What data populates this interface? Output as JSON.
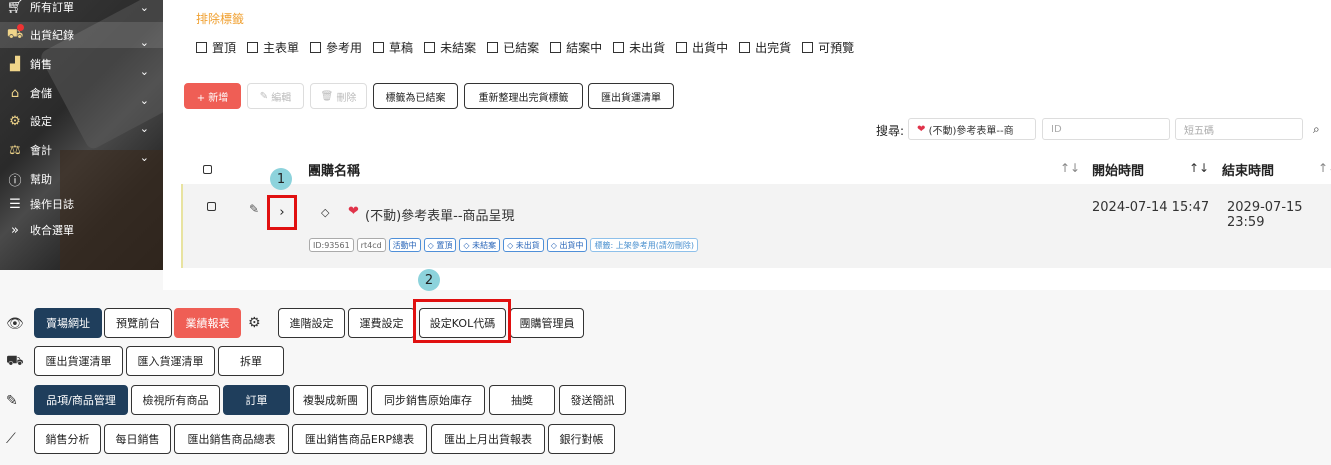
{
  "sidebar": {
    "items": [
      {
        "label": "所有訂單",
        "icon": "cart-icon"
      },
      {
        "label": "出貨紀錄",
        "icon": "truck-icon"
      },
      {
        "label": "銷售",
        "icon": "bar-chart-icon"
      },
      {
        "label": "倉儲",
        "icon": "warehouse-icon"
      },
      {
        "label": "設定",
        "icon": "gear-icon"
      },
      {
        "label": "會計",
        "icon": "scale-icon"
      },
      {
        "label": "幫助",
        "icon": "help-icon"
      },
      {
        "label": "操作日誌",
        "icon": "list-icon"
      },
      {
        "label": "收合選單",
        "icon": "double-chevron-icon"
      }
    ]
  },
  "filters": {
    "title": "排除標籤",
    "options": [
      "置頂",
      "主表單",
      "參考用",
      "草稿",
      "未結案",
      "已結案",
      "結案中",
      "未出貨",
      "出貨中",
      "出完貨",
      "可預覽"
    ]
  },
  "toolbar": {
    "add": "+ 新增",
    "edit": "編輯",
    "delete": "刪除",
    "mark_closed": "標籤為已結案",
    "reorganize": "重新整理出完貨標籤",
    "export_shipping": "匯出貨運清單"
  },
  "search": {
    "label": "搜尋:",
    "value": "(不動)參考表單--商",
    "id_placeholder": "ID",
    "code_placeholder": "短五碼"
  },
  "table": {
    "headers": {
      "name": "團購名稱",
      "start": "開始時間",
      "end": "結束時間"
    },
    "row": {
      "title": "(不動)參考表單--商品呈現",
      "start": "2024-07-14 15:47",
      "end": "2029-07-15 23:59",
      "chips": [
        "ID:93561",
        "rt4cd",
        "活動中",
        "置頂",
        "未結案",
        "未出貨",
        "出貨中",
        "標籤: 上架參考用(請勿刪除)"
      ]
    }
  },
  "badges": {
    "one": "1",
    "two": "2"
  },
  "actions": {
    "row1": [
      "賣場網址",
      "預覽前台",
      "業績報表",
      "進階設定",
      "運費設定",
      "設定KOL代碼",
      "團購管理員"
    ],
    "row2": [
      "匯出貨運清單",
      "匯入貨運清單",
      "拆單"
    ],
    "row3": [
      "品項/商品管理",
      "檢視所有商品",
      "訂單",
      "複製成新團",
      "同步銷售原始庫存",
      "抽獎",
      "發送簡訊"
    ],
    "row4": [
      "銷售分析",
      "每日銷售",
      "匯出銷售商品總表",
      "匯出銷售商品ERP總表",
      "匯出上月出貨報表",
      "銀行對帳"
    ]
  },
  "colors": {
    "accent_red": "#ef5e55",
    "dark_navy": "#1f3e5c",
    "highlight_red": "#e01010",
    "badge_teal": "#8dd3dc",
    "filter_orange": "#f0a030"
  }
}
